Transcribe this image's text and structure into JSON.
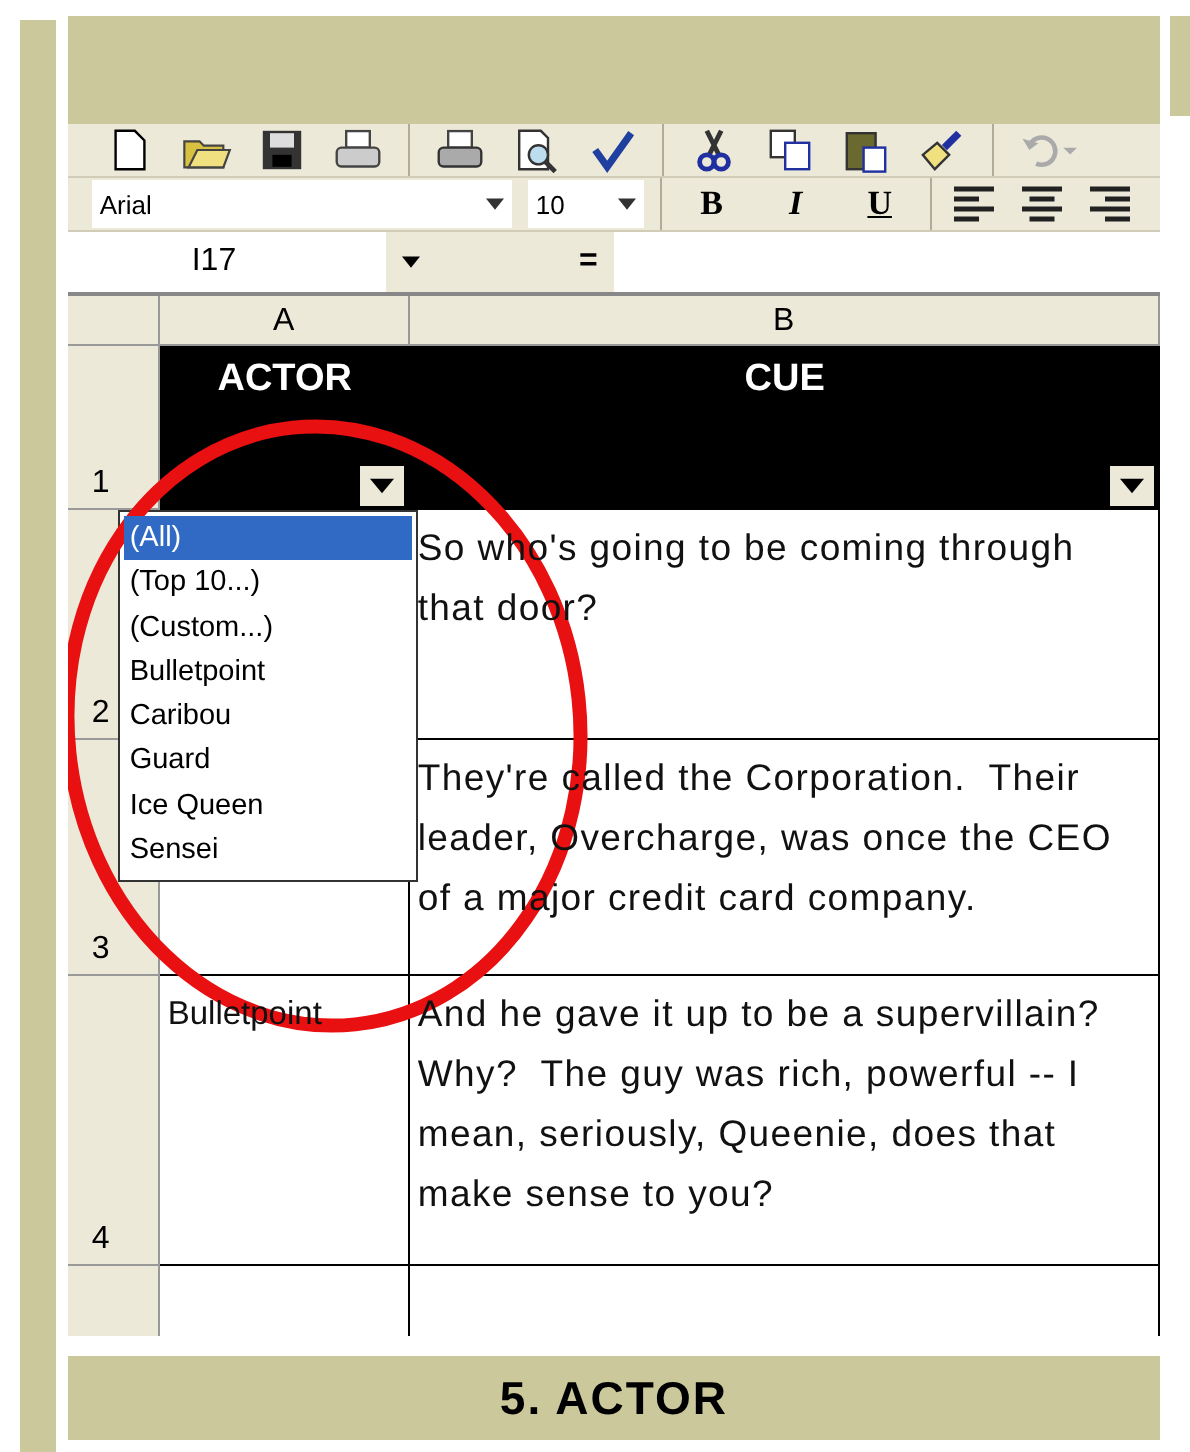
{
  "toolbar": {
    "font": "Arial",
    "size": "10",
    "bold": "B",
    "italic": "I",
    "underline": "U"
  },
  "formula_bar": {
    "name_box": "I17",
    "equals": "="
  },
  "columns": [
    "A",
    "B"
  ],
  "header_row": {
    "number": "1",
    "cells": [
      "ACTOR",
      "CUE"
    ]
  },
  "rows": [
    {
      "number": "2",
      "cue": "So who's going to be coming through that door?"
    },
    {
      "number": "3",
      "cue": "They're called the Corporation.  Their leader, Overcharge, was once the CEO of a major credit card company."
    },
    {
      "number": "4",
      "actor": "Bulletpoint",
      "cue": "And he gave it up to be a supervillain?  Why?  The guy was rich, powerful -- I mean, seriously, Queenie, does that make sense to you?"
    }
  ],
  "filter_list": {
    "items": [
      {
        "label": "(All)",
        "selected": true
      },
      {
        "label": "(Top 10...)",
        "selected": false
      },
      {
        "label": "(Custom...)",
        "selected": false
      },
      {
        "label": "Bulletpoint",
        "selected": false
      },
      {
        "label": "Caribou",
        "selected": false
      },
      {
        "label": "Guard",
        "selected": false
      },
      {
        "label": "Ice Queen",
        "selected": false
      },
      {
        "label": "Sensei",
        "selected": false
      }
    ]
  },
  "caption": "5. ACTOR"
}
